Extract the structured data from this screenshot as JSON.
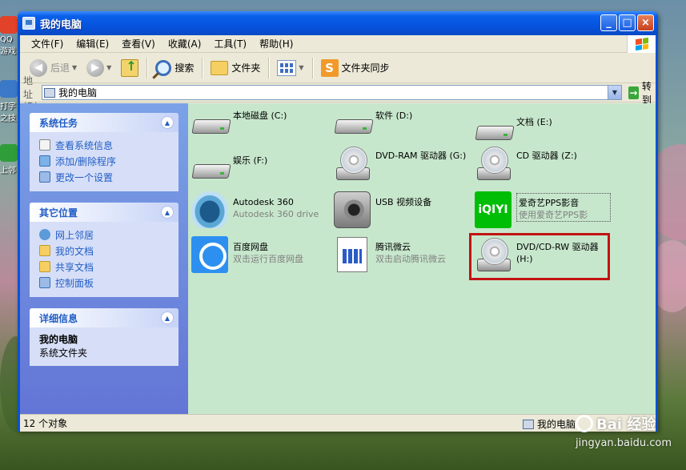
{
  "desktop": {
    "icons": [
      {
        "label": "QQ游戏"
      },
      {
        "label": "打字之技"
      },
      {
        "label": "上邻"
      }
    ]
  },
  "window": {
    "title": "我的电脑",
    "controls": {
      "minimize": "_",
      "maximize": "□",
      "close": "×"
    }
  },
  "menu": [
    "文件(F)",
    "编辑(E)",
    "查看(V)",
    "收藏(A)",
    "工具(T)",
    "帮助(H)"
  ],
  "toolbar": {
    "back": "后退",
    "search": "搜索",
    "folders": "文件夹",
    "sync": "文件夹同步"
  },
  "address": {
    "label": "地址(D)",
    "value": "我的电脑",
    "go": "转到"
  },
  "sidebar": {
    "system_tasks": {
      "title": "系统任务",
      "items": [
        "查看系统信息",
        "添加/删除程序",
        "更改一个设置"
      ]
    },
    "other_places": {
      "title": "其它位置",
      "items": [
        "网上邻居",
        "我的文档",
        "共享文档",
        "控制面板"
      ]
    },
    "details": {
      "title": "详细信息",
      "name": "我的电脑",
      "type": "系统文件夹"
    }
  },
  "items": [
    {
      "name": "本地磁盘 (C:)"
    },
    {
      "name": "软件 (D:)"
    },
    {
      "name": "文档 (E:)"
    },
    {
      "name": "娱乐 (F:)"
    },
    {
      "name": "DVD-RAM 驱动器 (G:)"
    },
    {
      "name": "CD 驱动器 (Z:)"
    },
    {
      "name": "Autodesk 360",
      "sub": "Autodesk 360 drive"
    },
    {
      "name": "USB 视频设备"
    },
    {
      "name": "爱奇艺PPS影音",
      "sub": "使用爱奇艺PPS影"
    },
    {
      "name": "百度网盘",
      "sub": "双击运行百度网盘"
    },
    {
      "name": "腾讯微云",
      "sub": "双击启动腾讯微云"
    },
    {
      "name": "DVD/CD-RW 驱动器",
      "sub": "(H:)"
    }
  ],
  "iqiyi_logo_text": "iQIYI",
  "status": {
    "count": "12 个对象",
    "location": "我的电脑"
  },
  "watermark": {
    "logo": "Bai 经验",
    "url": "jingyan.baidu.com"
  },
  "colors": {
    "highlight": "#c21313",
    "sidebar_link": "#215dc6",
    "content_bg": "#c7e7cc"
  }
}
